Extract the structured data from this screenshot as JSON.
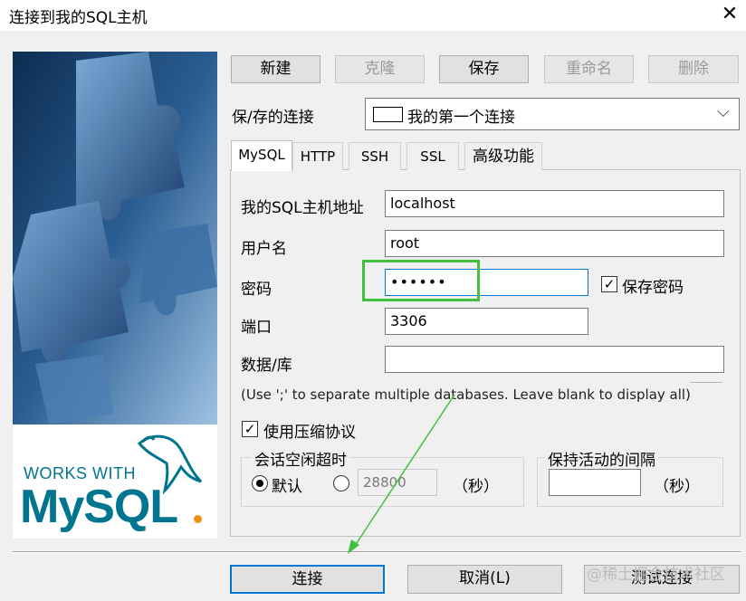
{
  "window": {
    "title": "连接到我的SQL主机"
  },
  "toolbar": {
    "new_label": "新建",
    "clone_label": "克隆",
    "save_label": "保存",
    "rename_label": "重命名",
    "delete_label": "删除"
  },
  "saved_connections": {
    "label": "保/存的连接",
    "selected": "我的第一个连接"
  },
  "tabs": [
    {
      "label": "MySQL",
      "active": true
    },
    {
      "label": "HTTP"
    },
    {
      "label": "SSH"
    },
    {
      "label": "SSL"
    },
    {
      "label": "高级功能"
    }
  ],
  "form": {
    "host_label": "我的SQL主机地址",
    "host_value": "localhost",
    "user_label": "用户名",
    "user_value": "root",
    "password_label": "密码",
    "password_value": "••••••",
    "save_password_label": "保存密码",
    "port_label": "端口",
    "port_value": "3306",
    "database_label": "数据/库",
    "database_value": "",
    "database_hint": "(Use ';' to separate multiple databases. Leave blank to display all)",
    "compress_label": "使用压缩协议",
    "session_timeout": {
      "title": "会话空闲超时",
      "default_label": "默认",
      "custom_value": "28800",
      "unit": "（秒）"
    },
    "keepalive": {
      "title": "保持活动的间隔",
      "value": "",
      "unit": "（秒）"
    }
  },
  "footer": {
    "connect_label": "连接",
    "cancel_label": "取消(L)",
    "test_label": "测试连接",
    "watermark": "@稀土掘金技术社区"
  },
  "logo": {
    "works_with": "WORKS WITH",
    "brand": "MySQL"
  },
  "colors": {
    "annotation_green": "#3fc13f",
    "mysql_blue": "#00758f",
    "mysql_orange": "#f29111",
    "puzzle_blue": "#1c3f6e"
  }
}
